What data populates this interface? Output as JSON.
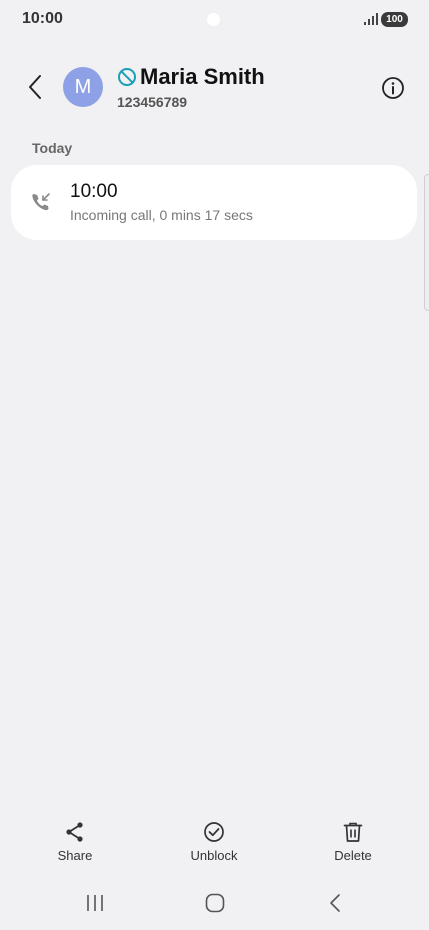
{
  "status_bar": {
    "time": "10:00",
    "battery": "100",
    "icons": [
      "signal-icon",
      "battery-icon"
    ]
  },
  "header": {
    "avatar_letter": "M",
    "contact_name": "Maria Smith",
    "phone_number": "123456789",
    "icons": [
      "back-icon",
      "blocked-icon",
      "info-icon"
    ],
    "accent_color": "#1a9fb8",
    "avatar_color": "#8ea0e6"
  },
  "log": {
    "section_label": "Today",
    "entries": [
      {
        "time": "10:00",
        "detail": "Incoming call, 0 mins 17 secs",
        "icon": "incoming-call-icon"
      }
    ]
  },
  "actions": {
    "share_label": "Share",
    "unblock_label": "Unblock",
    "delete_label": "Delete",
    "icons": [
      "share-icon",
      "unblock-check-icon",
      "trash-icon"
    ]
  },
  "nav_bar": {
    "icons": [
      "recent-apps-icon",
      "home-icon",
      "nav-back-icon"
    ]
  }
}
